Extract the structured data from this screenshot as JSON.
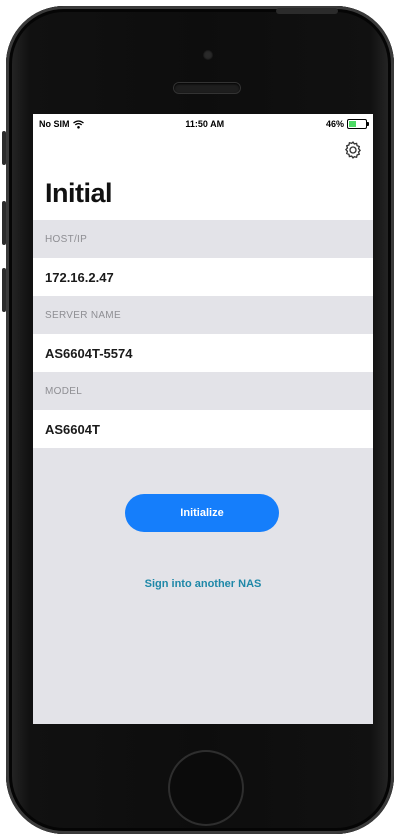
{
  "status_bar": {
    "carrier": "No SIM",
    "time": "11:50 AM",
    "battery": "46%",
    "battery_level": 0.46
  },
  "header": {
    "title": "Initial",
    "settings_icon": "gear-icon"
  },
  "fields": [
    {
      "label": "HOST/IP",
      "value": "172.16.2.47"
    },
    {
      "label": "SERVER NAME",
      "value": "AS6604T-5574"
    },
    {
      "label": "MODEL",
      "value": "AS6604T"
    }
  ],
  "actions": {
    "initialize_label": "Initialize",
    "sign_in_link": "Sign into another NAS"
  },
  "colors": {
    "accent": "#157efb",
    "link": "#1e88a8",
    "background": "#e3e3e8"
  }
}
